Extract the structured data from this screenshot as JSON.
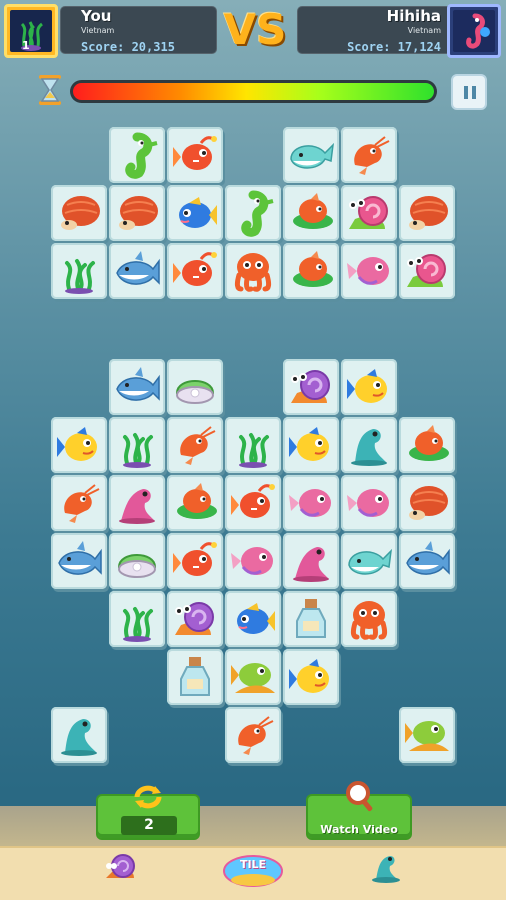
{
  "player": {
    "name": "You",
    "country": "Vietnam",
    "score": "Score: 20,315",
    "badge": "1"
  },
  "vs_label": "VS",
  "opponent": {
    "name": "Hihiha",
    "country": "Vietnam",
    "score": "Score: 17,124"
  },
  "timer": {
    "remaining_fraction": 1.0
  },
  "shuffle_button": {
    "count": "2"
  },
  "hint_button": {
    "label": "Watch Video"
  },
  "logo_text": "TILE",
  "colors": {
    "accent": "#ffb21c",
    "button": "#5ec23a",
    "tile": "#dff1f1",
    "water": "#3c7a92"
  },
  "board": {
    "tiles": [
      {
        "icon": "seahorse-icon",
        "row": 0,
        "col": 1
      },
      {
        "icon": "goldfish-icon",
        "row": 0,
        "col": 2
      },
      {
        "icon": "whale-icon",
        "row": 0,
        "col": 4
      },
      {
        "icon": "shrimp-icon",
        "row": 0,
        "col": 5
      },
      {
        "icon": "hermit-crab-icon",
        "row": 1,
        "col": 0
      },
      {
        "icon": "hermit-crab-icon",
        "row": 1,
        "col": 1
      },
      {
        "icon": "blue-fish-icon",
        "row": 1,
        "col": 2
      },
      {
        "icon": "seahorse-icon",
        "row": 1,
        "col": 3
      },
      {
        "icon": "seaweed-fish-icon",
        "row": 1,
        "col": 4
      },
      {
        "icon": "snail-icon",
        "row": 1,
        "col": 5
      },
      {
        "icon": "hermit-crab-icon",
        "row": 1,
        "col": 6
      },
      {
        "icon": "seaweed-icon",
        "row": 2,
        "col": 0
      },
      {
        "icon": "shark-icon",
        "row": 2,
        "col": 1
      },
      {
        "icon": "goldfish-icon",
        "row": 2,
        "col": 2
      },
      {
        "icon": "octopus-icon",
        "row": 2,
        "col": 3
      },
      {
        "icon": "seaweed-fish-icon",
        "row": 2,
        "col": 4
      },
      {
        "icon": "pink-fish-icon",
        "row": 2,
        "col": 5
      },
      {
        "icon": "snail-icon",
        "row": 2,
        "col": 6
      },
      {
        "icon": "shark-icon",
        "row": 4,
        "col": 1
      },
      {
        "icon": "clam-icon",
        "row": 4,
        "col": 2
      },
      {
        "icon": "purple-snail-icon",
        "row": 4,
        "col": 4
      },
      {
        "icon": "yellow-fish-icon",
        "row": 4,
        "col": 5
      },
      {
        "icon": "yellow-fish-icon",
        "row": 5,
        "col": 0
      },
      {
        "icon": "seaweed-icon",
        "row": 5,
        "col": 1
      },
      {
        "icon": "shrimp-icon",
        "row": 5,
        "col": 2
      },
      {
        "icon": "seaweed-icon",
        "row": 5,
        "col": 3
      },
      {
        "icon": "yellow-fish-icon",
        "row": 5,
        "col": 4
      },
      {
        "icon": "seal-icon",
        "row": 5,
        "col": 5
      },
      {
        "icon": "seaweed-fish-icon",
        "row": 5,
        "col": 6
      },
      {
        "icon": "shrimp-icon",
        "row": 6,
        "col": 0
      },
      {
        "icon": "pink-seal-icon",
        "row": 6,
        "col": 1
      },
      {
        "icon": "seaweed-fish-icon",
        "row": 6,
        "col": 2
      },
      {
        "icon": "goldfish-icon",
        "row": 6,
        "col": 3
      },
      {
        "icon": "pink-fish-icon",
        "row": 6,
        "col": 4
      },
      {
        "icon": "pink-fish-icon",
        "row": 6,
        "col": 5
      },
      {
        "icon": "hermit-crab-icon",
        "row": 6,
        "col": 6
      },
      {
        "icon": "shark-icon",
        "row": 7,
        "col": 0
      },
      {
        "icon": "clam-icon",
        "row": 7,
        "col": 1
      },
      {
        "icon": "goldfish-icon",
        "row": 7,
        "col": 2
      },
      {
        "icon": "pink-fish-icon",
        "row": 7,
        "col": 3
      },
      {
        "icon": "pink-seal-icon",
        "row": 7,
        "col": 4
      },
      {
        "icon": "whale-icon",
        "row": 7,
        "col": 5
      },
      {
        "icon": "shark-icon",
        "row": 7,
        "col": 6
      },
      {
        "icon": "seaweed-icon",
        "row": 8,
        "col": 1
      },
      {
        "icon": "purple-snail-icon",
        "row": 8,
        "col": 2
      },
      {
        "icon": "blue-fish-icon",
        "row": 8,
        "col": 3
      },
      {
        "icon": "bottle-icon",
        "row": 8,
        "col": 4
      },
      {
        "icon": "octopus-icon",
        "row": 8,
        "col": 5
      },
      {
        "icon": "bottle-icon",
        "row": 9,
        "col": 2
      },
      {
        "icon": "green-fish-icon",
        "row": 9,
        "col": 3
      },
      {
        "icon": "yellow-fish-icon",
        "row": 9,
        "col": 4
      },
      {
        "icon": "seal-icon",
        "row": 10,
        "col": 0
      },
      {
        "icon": "shrimp-icon",
        "row": 10,
        "col": 3
      },
      {
        "icon": "green-fish-icon",
        "row": 10,
        "col": 6
      }
    ]
  }
}
